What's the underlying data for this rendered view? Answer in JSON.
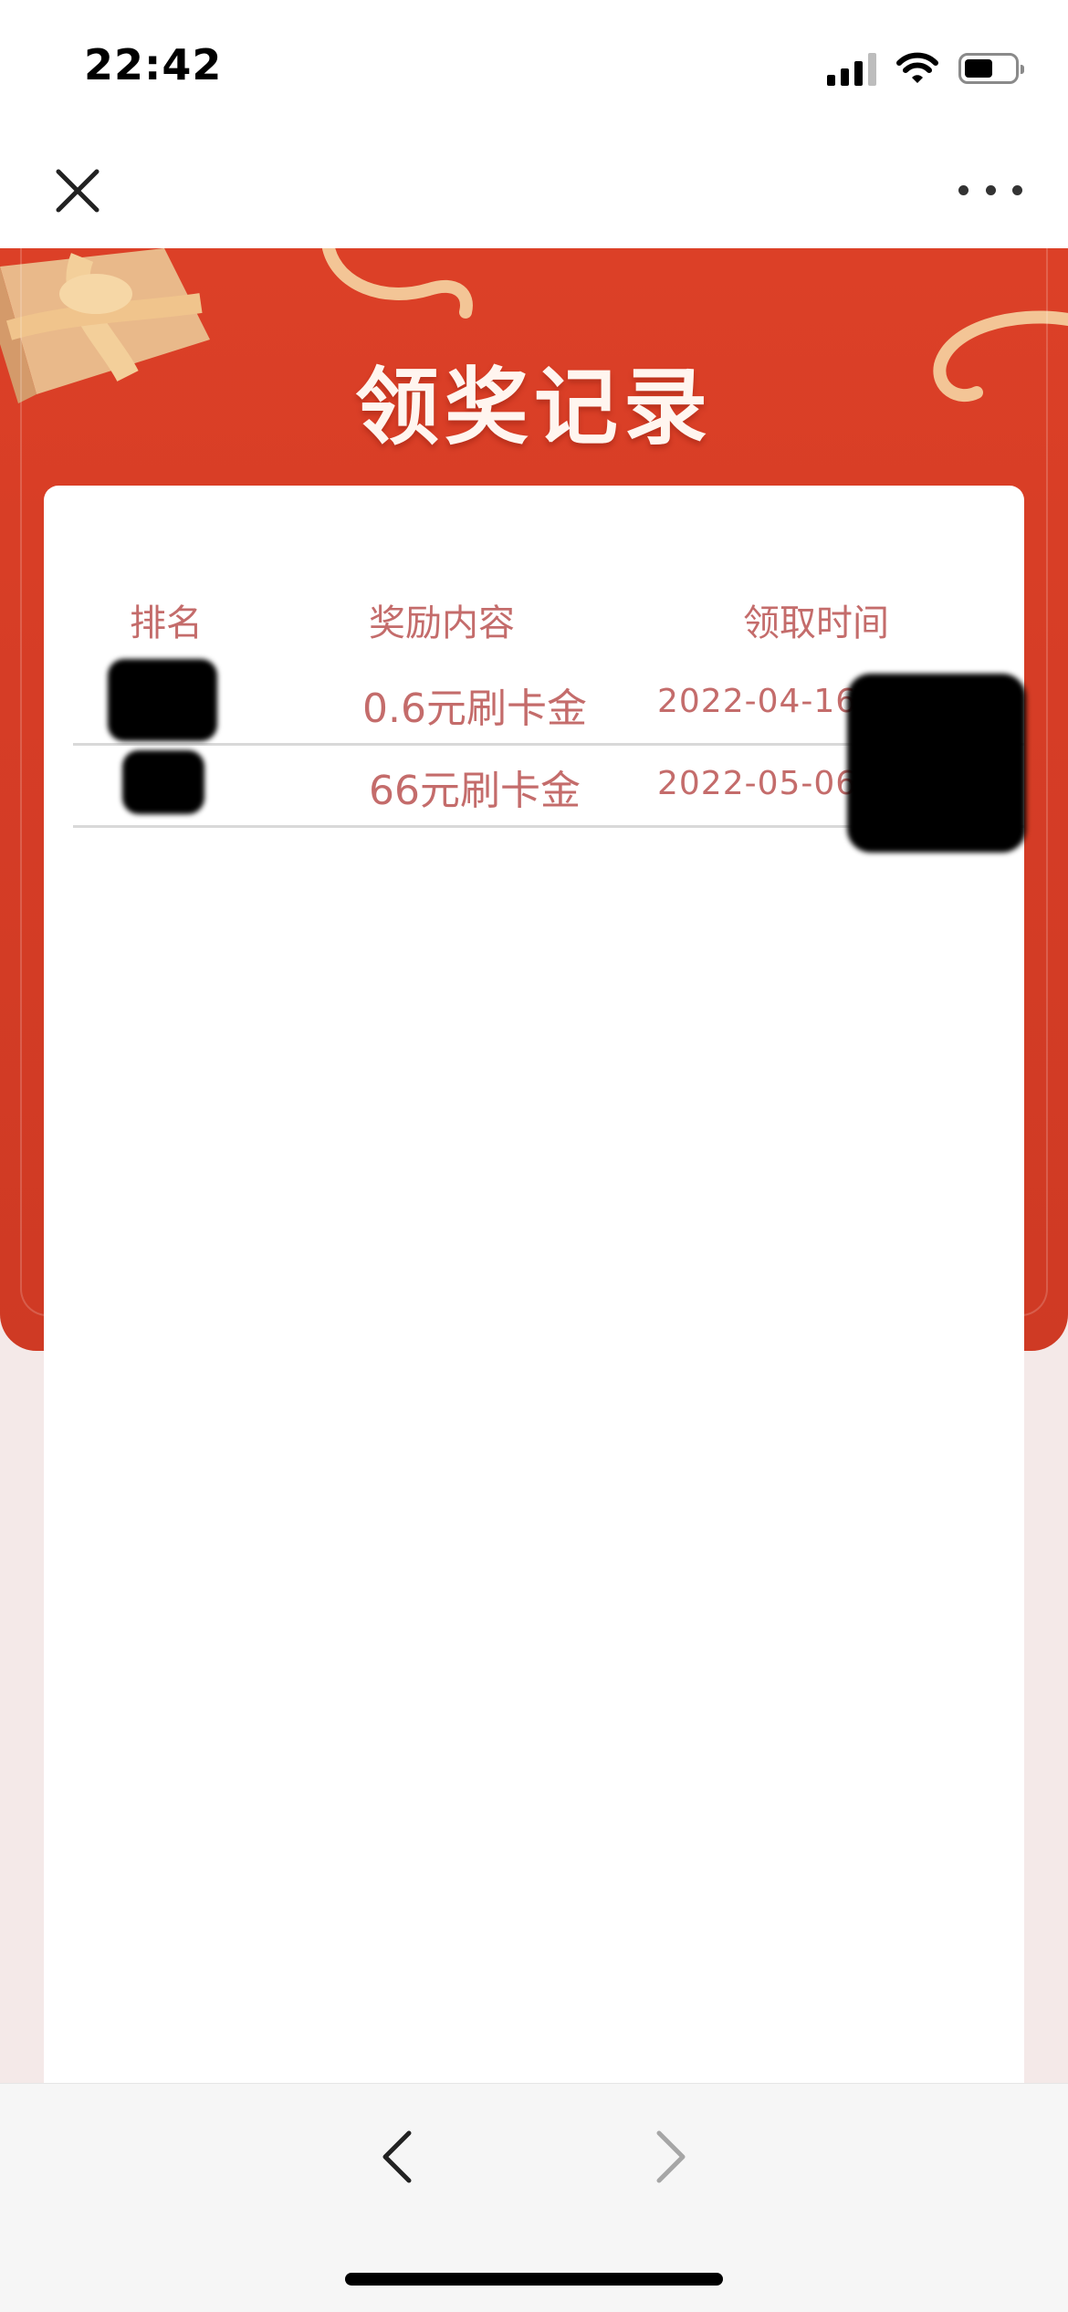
{
  "status_bar": {
    "time": "22:42",
    "icons": [
      "signal-icon",
      "wifi-icon",
      "battery-icon"
    ]
  },
  "nav": {
    "close_icon": "close-icon",
    "more_icon": "more-icon"
  },
  "page": {
    "title": "领奖记录"
  },
  "table": {
    "headers": {
      "rank": "排名",
      "reward": "奖励内容",
      "time": "领取时间"
    },
    "rows": [
      {
        "reward": "0.6元刷卡金",
        "time": "2022-04-16"
      },
      {
        "reward": "66元刷卡金",
        "time": "2022-05-06"
      }
    ]
  },
  "bottom_bar": {
    "icons": [
      "back-icon",
      "forward-icon"
    ]
  },
  "colors": {
    "header_red": "#d63d26",
    "text_pink": "#c46c6b",
    "card_bg": "#ffffff",
    "page_bg": "#f4e9e8"
  }
}
